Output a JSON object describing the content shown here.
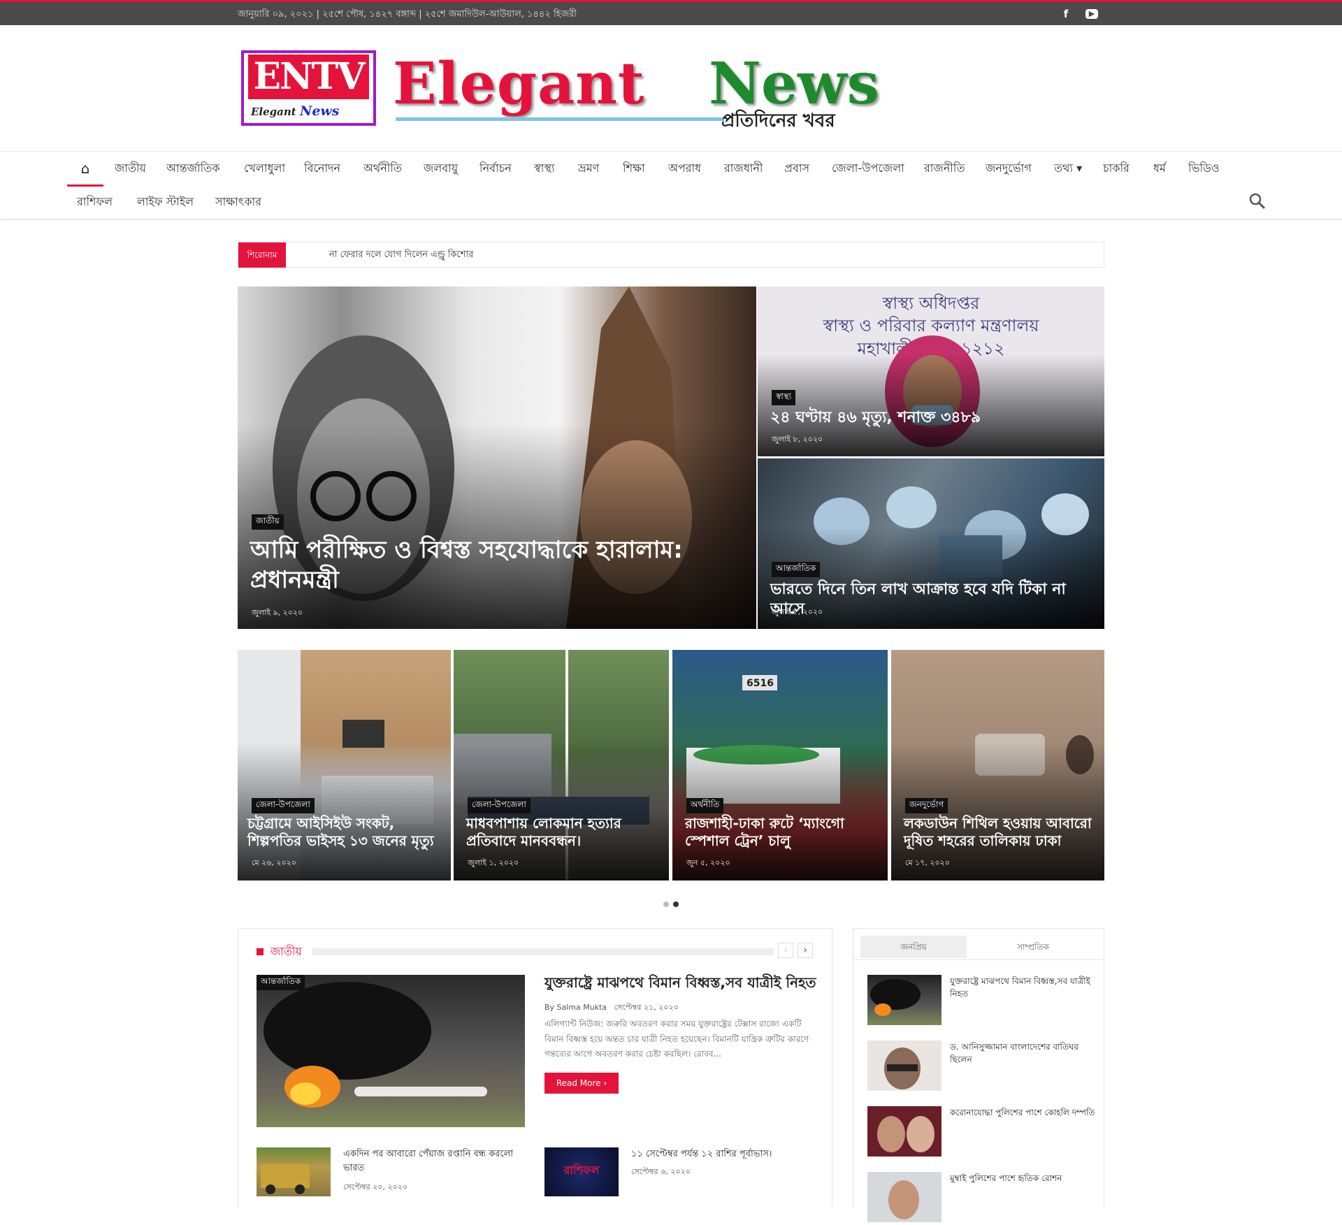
{
  "topbar": {
    "date": "জানুয়ারি ০৯, ২০২১ | ২৫শে পৌষ, ১৪২৭ বঙ্গাব্দ | ২৫শে জমাদিউল-আউয়াল, ১৪৪২ হিজরী",
    "facebook_icon": "f",
    "youtube_icon": "▶"
  },
  "logo": {
    "badge": "ENTV",
    "badge_sub_1": "Elegant",
    "badge_sub_2": "News",
    "brand_1": "Elegant",
    "brand_2": "News",
    "tagline": "প্রতিদিনের খবর"
  },
  "nav": {
    "home_icon": "⌂",
    "row1": [
      "জাতীয়",
      "আন্তর্জাতিক",
      "খেলাধুলা",
      "বিনোদন",
      "অর্থনীতি",
      "জলবায়ু",
      "নির্বাচন",
      "স্বাস্থ্য",
      "ভ্রমণ",
      "শিক্ষা",
      "অপরাধ",
      "রাজধানী",
      "প্রবাস",
      "জেলা-উপজেলা",
      "রাজনীতি",
      "জনদুর্ভোগ",
      "তথ্য ▾",
      "চাকরি",
      "ধর্ম",
      "ভিডিও"
    ],
    "row2": [
      "রাশিফল",
      "লাইফ স্টাইল",
      "সাক্ষাৎকার"
    ]
  },
  "ticker": {
    "label": "শিরোনাম",
    "text": "না ফেরার দলে যোগ দিলেন এন্ড্রু কিশোর"
  },
  "featured": {
    "main": {
      "category": "জাতীয়",
      "title": "আমি পরীক্ষিত ও বিশ্বস্ত সহযোদ্ধাকে হারালাম: প্রধানমন্ত্রী",
      "date": "জুলাই ৯, ২০২০"
    },
    "side1": {
      "category": "স্বাস্থ্য",
      "title": "২৪ ঘণ্টায় ৪৬ মৃত্যু, শনাক্ত ৩৪৮৯",
      "date": "জুলাই ৮, ২০২০",
      "image_text_1": "স্বাস্থ্য অধিদপ্তর",
      "image_text_2": "স্বাস্থ্য ও পরিবার কল্যাণ মন্ত্রণালয়",
      "image_text_3": "মহাখালী, ঢাকা-১২১২"
    },
    "side2": {
      "category": "আন্তর্জাতিক",
      "title": "ভারতে দিনে তিন লাখ আক্রান্ত হবে যদি টিকা না আসে",
      "date": "জুলাই ৮, ২০২০"
    }
  },
  "slider": [
    {
      "category": "জেলা-উপজেলা",
      "title": "চট্টগ্রামে আইসিইউ সংকট, শিল্পপতির ভাইসহ ১৩ জনের মৃত্যু",
      "date": "মে ২৬, ২০২০"
    },
    {
      "category": "জেলা-উপজেলা",
      "title": "মাধবপাশায় লোকমান হত্যার প্রতিবাদে মানববন্ধন।",
      "date": "জুলাই ১, ২০২০"
    },
    {
      "category": "অর্থনীতি",
      "title": "রাজশাহী-ঢাকা রুটে ‘ম্যাংগো স্পেশাল ট্রেন’ চালু",
      "date": "জুন ৫, ২০২০",
      "image_text": "6516"
    },
    {
      "category": "জনদুর্ভোগ",
      "title": "লকডাউন শিথিল হওয়ায় আবারো দূষিত শহরের তালিকায় ঢাকা",
      "date": "মে ১৭, ২০২০"
    }
  ],
  "section": {
    "title": "জাতীয়",
    "prev": "‹",
    "next": "›",
    "lead": {
      "category": "আন্তর্জাতিক",
      "title": "যুক্তরাষ্ট্রে মাঝপথে বিমান বিধ্বস্ত,সব যাত্রীই নিহত",
      "author": "By Salma Mukta",
      "date": "সেপ্টেম্বর ২১, ২০২০",
      "excerpt": "এলিগ্যান্ট নিউজ: জরুরি অবতরণ করার সময় যুক্তরাষ্ট্রের টেক্সাস রাজ্যে একটি বিমান বিধ্বস্ত হয়ে অন্তত চার যাত্রী নিহত হয়েছেন। বিমানটি যান্ত্রিক ত্রুটির কারণে গন্তব্যের আগে অবতরণ করার চেষ্টা করছিল। রোবব...",
      "read_more": "Read More ›"
    },
    "small": [
      {
        "title": "একদিন পর আবারো পেঁয়াজ রপ্তানি বন্ধ করলো ভারত",
        "date": "সেপ্টেম্বর ২০, ২০২০"
      },
      {
        "title": "১১ সেপ্টেম্বর পর্যন্ত ১২ রাশির পূর্বাভাস।",
        "date": "সেপ্টেম্বর ৬, ২০২০",
        "image_text": "রাশিফল"
      }
    ]
  },
  "sidebar": {
    "tabs": [
      "জনপ্রিয়",
      "সাম্প্রতিক"
    ],
    "items": [
      {
        "title": "যুক্তরাষ্ট্রে মাঝপথে বিমান বিধ্বস্ত,সব যাত্রীই নিহত"
      },
      {
        "title": "ড. আনিসুজ্জামান বাংলাদেশের বাতিঘর ছিলেন"
      },
      {
        "title": "করোনাযোদ্ধা পুলিশের পাশে কোহলি দম্পতি"
      },
      {
        "title": "মুম্বাই পুলিশের পাশে হৃতিক রোশন"
      }
    ]
  },
  "colors": {
    "accent": "#e4133b",
    "topbar": "#4a4a4a",
    "brand_green": "#1e8a2e"
  }
}
